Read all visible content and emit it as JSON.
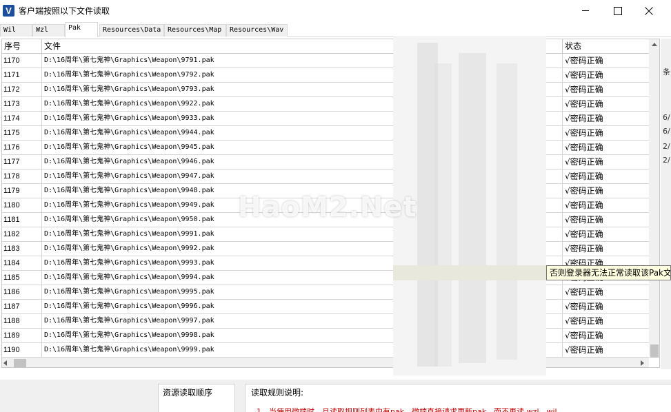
{
  "window": {
    "title": "客户端按照以下文件读取",
    "app_icon": "V"
  },
  "tabs": [
    "Wil",
    "Wzl",
    "Pak",
    "Resources\\Data",
    "Resources\\Map",
    "Resources\\Wav"
  ],
  "active_tab": "Pak",
  "table": {
    "columns": [
      "序号",
      "文件",
      "状态"
    ],
    "rows": [
      {
        "id": "1170",
        "file": "D:\\16周年\\第七鬼神\\Graphics\\Weapon\\9791.pak",
        "status": "√密码正确"
      },
      {
        "id": "1171",
        "file": "D:\\16周年\\第七鬼神\\Graphics\\Weapon\\9792.pak",
        "status": "√密码正确"
      },
      {
        "id": "1172",
        "file": "D:\\16周年\\第七鬼神\\Graphics\\Weapon\\9793.pak",
        "status": "√密码正确"
      },
      {
        "id": "1173",
        "file": "D:\\16周年\\第七鬼神\\Graphics\\Weapon\\9922.pak",
        "status": "√密码正确"
      },
      {
        "id": "1174",
        "file": "D:\\16周年\\第七鬼神\\Graphics\\Weapon\\9933.pak",
        "status": "√密码正确"
      },
      {
        "id": "1175",
        "file": "D:\\16周年\\第七鬼神\\Graphics\\Weapon\\9944.pak",
        "status": "√密码正确"
      },
      {
        "id": "1176",
        "file": "D:\\16周年\\第七鬼神\\Graphics\\Weapon\\9945.pak",
        "status": "√密码正确"
      },
      {
        "id": "1177",
        "file": "D:\\16周年\\第七鬼神\\Graphics\\Weapon\\9946.pak",
        "status": "√密码正确"
      },
      {
        "id": "1178",
        "file": "D:\\16周年\\第七鬼神\\Graphics\\Weapon\\9947.pak",
        "status": "√密码正确"
      },
      {
        "id": "1179",
        "file": "D:\\16周年\\第七鬼神\\Graphics\\Weapon\\9948.pak",
        "status": "√密码正确"
      },
      {
        "id": "1180",
        "file": "D:\\16周年\\第七鬼神\\Graphics\\Weapon\\9949.pak",
        "status": "√密码正确"
      },
      {
        "id": "1181",
        "file": "D:\\16周年\\第七鬼神\\Graphics\\Weapon\\9950.pak",
        "status": "√密码正确"
      },
      {
        "id": "1182",
        "file": "D:\\16周年\\第七鬼神\\Graphics\\Weapon\\9991.pak",
        "status": "√密码正确"
      },
      {
        "id": "1183",
        "file": "D:\\16周年\\第七鬼神\\Graphics\\Weapon\\9992.pak",
        "status": "√密码正确"
      },
      {
        "id": "1184",
        "file": "D:\\16周年\\第七鬼神\\Graphics\\Weapon\\9993.pak",
        "status": "√密码正确"
      },
      {
        "id": "1185",
        "file": "D:\\16周年\\第七鬼神\\Graphics\\Weapon\\9994.pak",
        "status": "√密码正确"
      },
      {
        "id": "1186",
        "file": "D:\\16周年\\第七鬼神\\Graphics\\Weapon\\9995.pak",
        "status": "√密码正确"
      },
      {
        "id": "1187",
        "file": "D:\\16周年\\第七鬼神\\Graphics\\Weapon\\9996.pak",
        "status": "√密码正确"
      },
      {
        "id": "1188",
        "file": "D:\\16周年\\第七鬼神\\Graphics\\Weapon\\9997.pak",
        "status": "√密码正确"
      },
      {
        "id": "1189",
        "file": "D:\\16周年\\第七鬼神\\Graphics\\Weapon\\9998.pak",
        "status": "√密码正确"
      },
      {
        "id": "1190",
        "file": "D:\\16周年\\第七鬼神\\Graphics\\Weapon\\9999.pak",
        "status": "√密码正确"
      }
    ]
  },
  "right_edge_chars": [
    "条",
    "6/",
    "6/",
    "2/",
    "2/"
  ],
  "tooltip": "否则登录器无法正常读取该Pak文",
  "watermark": "HaoM2.Net",
  "bottom": {
    "order_label": "资源读取顺序",
    "rules_label": "读取规则说明:",
    "rules_text": "1、当使用微端时，且读取规则列表中有pak，微端直接请求更新pak，而不再读 wzl、wil"
  },
  "colors": {
    "rules_text": "#c00000",
    "app_icon_bg": "#1b4f9c",
    "tooltip_bg": "#ffffe1"
  },
  "icons": [
    "app-logo-icon",
    "minimize-icon",
    "maximize-icon",
    "close-icon",
    "scroll-up-icon",
    "scroll-left-icon",
    "scroll-right-icon"
  ]
}
